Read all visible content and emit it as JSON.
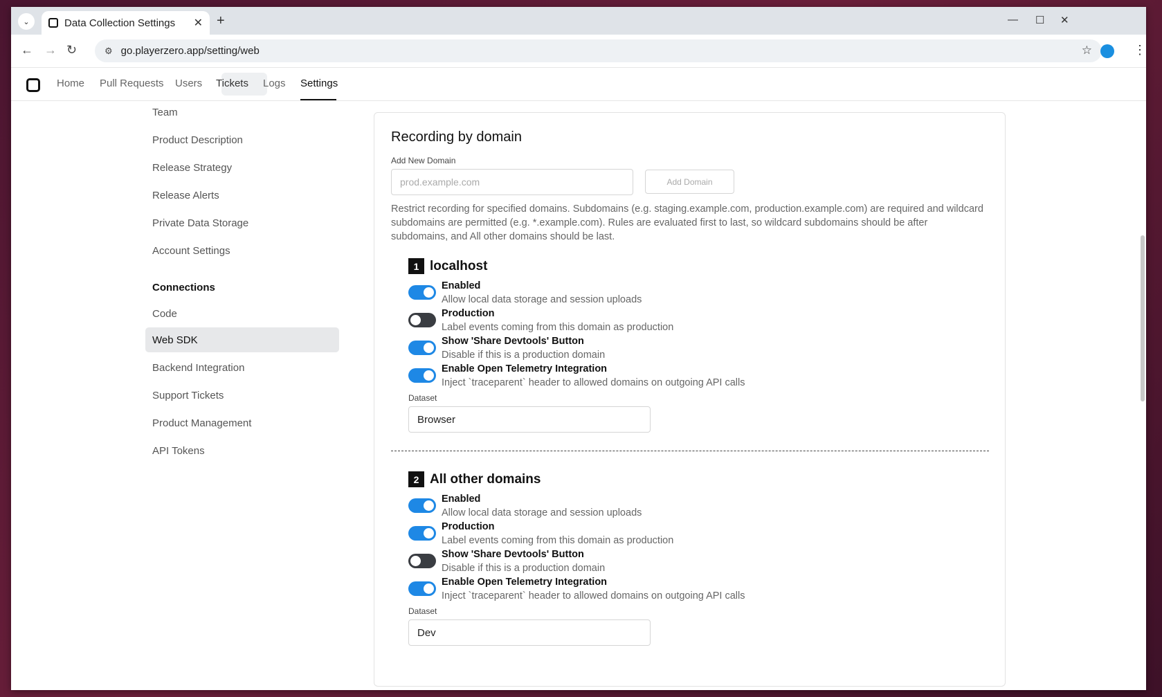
{
  "browser": {
    "tab_title": "Data Collection Settings",
    "url": "go.playerzero.app/setting/web"
  },
  "app_nav": {
    "items": [
      "Home",
      "Pull Requests",
      "Users",
      "Tickets",
      "Logs",
      "Settings"
    ],
    "active": "Settings"
  },
  "sidebar": {
    "top_items": [
      "Team",
      "Product Description",
      "Release Strategy",
      "Release Alerts",
      "Private Data Storage",
      "Account Settings"
    ],
    "section_heading": "Connections",
    "connection_items": [
      "Code",
      "Web SDK",
      "Backend Integration",
      "Support Tickets",
      "Product Management",
      "API Tokens"
    ],
    "selected": "Web SDK"
  },
  "main": {
    "title": "Recording by domain",
    "add_label": "Add New Domain",
    "add_placeholder": "prod.example.com",
    "add_button": "Add Domain",
    "description": "Restrict recording for specified domains. Subdomains (e.g. staging.example.com, production.example.com) are required and wildcard subdomains are permitted (e.g. *.example.com). Rules are evaluated first to last, so wildcard subdomains should be after subdomains, and All other domains should be last.",
    "rules": [
      {
        "number": "1",
        "name": "localhost",
        "options": [
          {
            "title": "Enabled",
            "subtitle": "Allow local data storage and session uploads",
            "on": true
          },
          {
            "title": "Production",
            "subtitle": "Label events coming from this domain as production",
            "on": false
          },
          {
            "title": "Show 'Share Devtools' Button",
            "subtitle": "Disable if this is a production domain",
            "on": true
          },
          {
            "title": "Enable Open Telemetry Integration",
            "subtitle": "Inject `traceparent` header to allowed domains on outgoing API calls",
            "on": true
          }
        ],
        "dataset_label": "Dataset",
        "dataset": "Browser"
      },
      {
        "number": "2",
        "name": "All other domains",
        "options": [
          {
            "title": "Enabled",
            "subtitle": "Allow local data storage and session uploads",
            "on": true
          },
          {
            "title": "Production",
            "subtitle": "Label events coming from this domain as production",
            "on": true
          },
          {
            "title": "Show 'Share Devtools' Button",
            "subtitle": "Disable if this is a production domain",
            "on": false
          },
          {
            "title": "Enable Open Telemetry Integration",
            "subtitle": "Inject `traceparent` header to allowed domains on outgoing API calls",
            "on": true
          }
        ],
        "dataset_label": "Dataset",
        "dataset": "Dev"
      }
    ]
  },
  "colors": {
    "toggle_on": "#1e88e5",
    "toggle_off": "#3a3d42"
  }
}
